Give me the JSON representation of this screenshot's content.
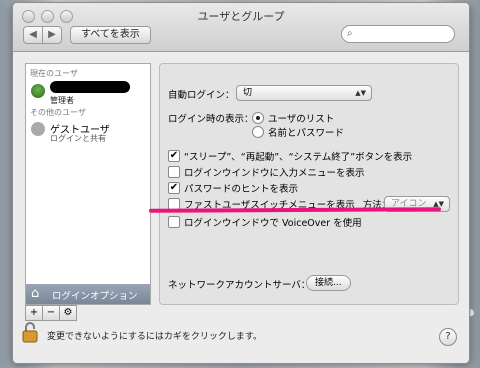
{
  "window": {
    "title": "ユーザとグループ"
  },
  "toolbar": {
    "show_all_label": "すべてを表示",
    "back_glyph": "◀",
    "forward_glyph": "▶",
    "search_placeholder": ""
  },
  "sidebar": {
    "current_user_header": "現在のユーザ",
    "current_user_role": "管理者",
    "other_users_header": "その他のユーザ",
    "guest_name": "ゲストユーザ",
    "guest_sub": "ログインと共有",
    "login_options_label": "ログインオプション",
    "add_label": "+",
    "remove_label": "−",
    "gear_label": "⚙"
  },
  "options": {
    "auto_login_label": "自動ログイン：",
    "auto_login_value": "切",
    "login_window_label": "ログイン時の表示：",
    "radio_user_list": "ユーザのリスト",
    "radio_name_password": "名前とパスワード",
    "radio_user_list_selected": true,
    "cb_sleep_restart": "“スリープ”、“再起動”、“システム終了”ボタンを表示",
    "cb_sleep_restart_checked": true,
    "cb_input_menu": "ログインウインドウに入力メニューを表示",
    "cb_input_menu_checked": false,
    "cb_password_hints": "パスワードのヒントを表示",
    "cb_password_hints_checked": true,
    "cb_fast_user_switch": "ファストユーザスイッチメニューを表示",
    "cb_fast_user_switch_checked": false,
    "method_label": "方法：",
    "method_value": "アイコン",
    "cb_voiceover": "ログインウインドウで VoiceOver を使用",
    "cb_voiceover_checked": false,
    "network_server_label": "ネットワークアカウントサーバ：",
    "join_button": "接続..."
  },
  "footer": {
    "lock_text": "変更できないようにするにはカギをクリックします。",
    "help_label": "?"
  },
  "colors": {
    "annotation_line": "#e8157e",
    "selected_row": "#8a96a8"
  }
}
